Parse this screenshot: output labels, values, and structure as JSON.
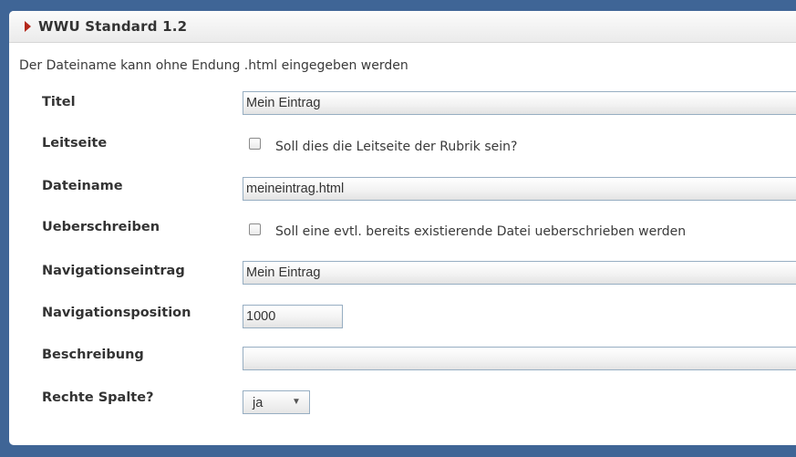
{
  "panel": {
    "title": "WWU Standard 1.2"
  },
  "notice": "Der Dateiname kann ohne Endung .html eingegeben werden",
  "fields": {
    "titel": {
      "label": "Titel",
      "value": "Mein Eintrag"
    },
    "leitseite": {
      "label": "Leitseite",
      "checkbox_label": "Soll dies die Leitseite der Rubrik sein?",
      "checked": false
    },
    "dateiname": {
      "label": "Dateiname",
      "value": "meineintrag.html"
    },
    "ueberschreiben": {
      "label": "Ueberschreiben",
      "checkbox_label": "Soll eine evtl. bereits existierende Datei ueberschrieben werden",
      "checked": false
    },
    "navigationseintrag": {
      "label": "Navigationseintrag",
      "value": "Mein Eintrag"
    },
    "navigationsposition": {
      "label": "Navigationsposition",
      "value": "1000"
    },
    "beschreibung": {
      "label": "Beschreibung",
      "value": ""
    },
    "rechte_spalte": {
      "label": "Rechte Spalte?",
      "selected": "ja"
    }
  },
  "colors": {
    "background": "#3f6596",
    "arrow": "#b4271b",
    "field_border": "#97aec2"
  },
  "icons": {
    "panel_toggle": "triangle-right-icon",
    "select_caret": "caret-down-icon"
  }
}
